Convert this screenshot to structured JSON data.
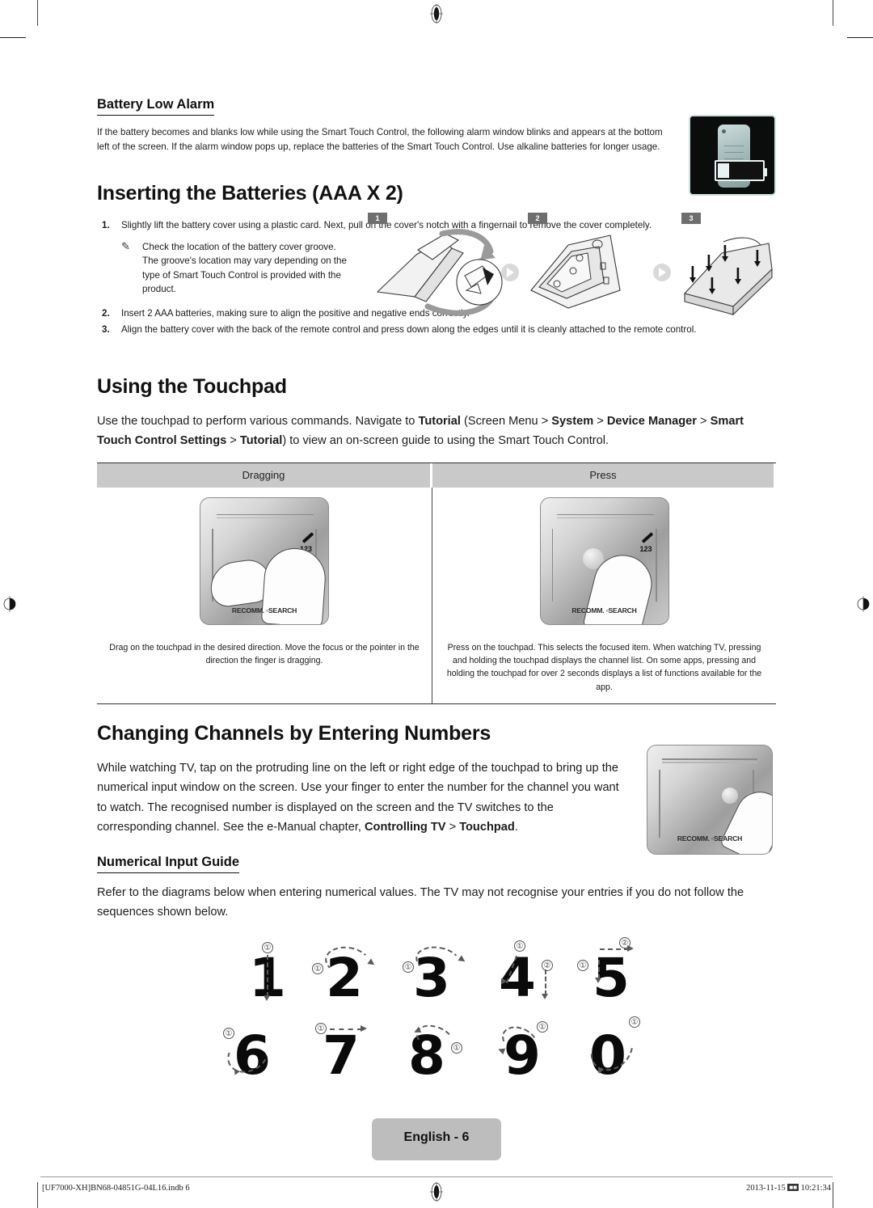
{
  "battery_low_alarm": {
    "heading": "Battery Low Alarm",
    "body": "If the battery becomes and blanks low while using the Smart Touch Control, the following alarm window blinks and appears at the bottom left of the screen. If the alarm window pops up, replace the batteries of the Smart Touch Control. Use alkaline batteries for longer usage.",
    "thumbnail_alt": "battery-low-alarm-window"
  },
  "inserting_batteries": {
    "heading": "Inserting the Batteries (AAA X 2)",
    "steps": [
      {
        "num": "1.",
        "text": "Slightly lift the battery cover using a plastic card. Next, pull on the cover's notch with a fingernail to remove the cover completely."
      },
      {
        "num": "2.",
        "text": "Insert 2 AAA batteries, making sure to align the positive and negative ends correctly."
      },
      {
        "num": "3.",
        "text": "Align the battery cover with the back of the remote control and press down along the edges until it is cleanly attached to the remote control."
      }
    ],
    "note": "Check the location of the battery cover groove. The groove's location may vary depending on the type of Smart Touch Control is provided with the product.",
    "figure_badges": [
      "1",
      "2",
      "3"
    ]
  },
  "using_touchpad": {
    "heading": "Using the Touchpad",
    "intro_parts": [
      {
        "t": "Use the touchpad to perform various commands. Navigate to ",
        "bold": false
      },
      {
        "t": "Tutorial",
        "bold": true
      },
      {
        "t": " (Screen Menu > ",
        "bold": false
      },
      {
        "t": "System",
        "bold": true
      },
      {
        "t": " > ",
        "bold": false
      },
      {
        "t": "Device Manager",
        "bold": true
      },
      {
        "t": " > ",
        "bold": false
      },
      {
        "t": "Smart Touch Control Settings",
        "bold": true
      },
      {
        "t": " > ",
        "bold": false
      },
      {
        "t": "Tutorial",
        "bold": true
      },
      {
        "t": ") to view an on-screen guide to using the Smart Touch Control.",
        "bold": false
      }
    ],
    "table": {
      "headers": [
        "Dragging",
        "Press"
      ],
      "descriptions": [
        "Drag on the touchpad in the desired direction.\nMove the focus or the pointer in the direction the finger is dragging.",
        "Press on the touchpad. This selects the focused item. When watching TV, pressing and holding the touchpad displays the channel list. On some apps, pressing and holding the touchpad for over 2 seconds displays a list of functions available for the app."
      ]
    },
    "pad_label": "RECOMM. ▫SEARCH",
    "pad_pen_label": "123"
  },
  "changing_channels": {
    "heading": "Changing Channels by Entering Numbers",
    "body_parts": [
      {
        "t": "While watching TV, tap on the protruding line on the left or right edge of the touchpad to bring up the numerical input window on the screen. Use your finger to enter the number for the channel you want to watch. The recognised number is displayed on the screen and the TV switches to the corresponding channel. See the e-Manual chapter, ",
        "bold": false
      },
      {
        "t": "Controlling TV",
        "bold": true
      },
      {
        "t": " > ",
        "bold": false
      },
      {
        "t": "Touchpad",
        "bold": true
      },
      {
        "t": ".",
        "bold": false
      }
    ],
    "thumb_label": "RECOMM. ▫SEARCH"
  },
  "numerical_input_guide": {
    "heading": "Numerical Input Guide",
    "body": "Refer to the diagrams below when entering numerical values. The TV may not recognise your entries if you do not follow the sequences shown below.",
    "rows": [
      [
        {
          "digit": "1",
          "strokes": [
            "①"
          ]
        },
        {
          "digit": "2",
          "strokes": [
            "①"
          ]
        },
        {
          "digit": "3",
          "strokes": [
            "①"
          ]
        },
        {
          "digit": "4",
          "strokes": [
            "①",
            "②"
          ]
        },
        {
          "digit": "5",
          "strokes": [
            "①",
            "②"
          ]
        }
      ],
      [
        {
          "digit": "6",
          "strokes": [
            "①"
          ]
        },
        {
          "digit": "7",
          "strokes": [
            "①"
          ]
        },
        {
          "digit": "8",
          "strokes": [
            "①"
          ]
        },
        {
          "digit": "9",
          "strokes": [
            "①"
          ]
        },
        {
          "digit": "0",
          "strokes": [
            "①"
          ]
        }
      ]
    ]
  },
  "footer": {
    "page_badge": "English - 6",
    "left": "[UF7000-XH]BN68-04851G-04L16.indb   6",
    "date": "2013-11-15",
    "time": "10:21:34"
  }
}
